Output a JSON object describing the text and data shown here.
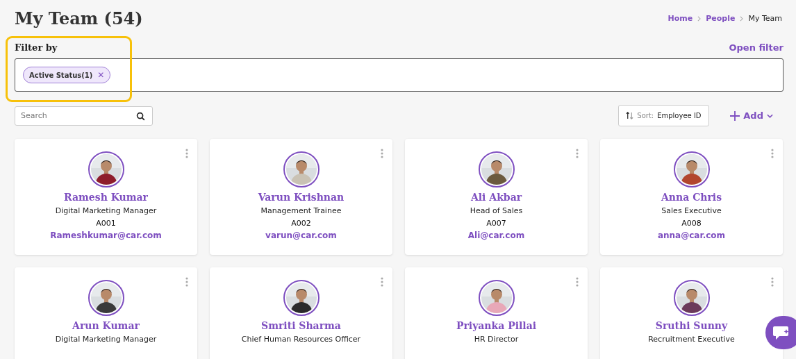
{
  "page": {
    "title": "My Team (54)"
  },
  "breadcrumb": [
    {
      "label": "Home",
      "current": false
    },
    {
      "label": "People",
      "current": false
    },
    {
      "label": "My Team",
      "current": true
    }
  ],
  "filter": {
    "label": "Filter by",
    "open_link": "Open filter",
    "chips": [
      {
        "label": "Active Status(1)",
        "remove": "✕"
      }
    ]
  },
  "search": {
    "placeholder": "Search"
  },
  "sort": {
    "label": "Sort:",
    "value": "Employee ID"
  },
  "add": {
    "label": "Add"
  },
  "members": [
    {
      "name": "Ramesh Kumar",
      "title": "Digital Marketing Manager",
      "id": "A001",
      "email": "Rameshkumar@car.com"
    },
    {
      "name": "Varun Krishnan",
      "title": "Management Trainee",
      "id": "A002",
      "email": "varun@car.com"
    },
    {
      "name": "Ali Akbar",
      "title": "Head of Sales",
      "id": "A007",
      "email": "Ali@car.com"
    },
    {
      "name": "Anna Chris",
      "title": "Sales Executive",
      "id": "A008",
      "email": "anna@car.com"
    },
    {
      "name": "Arun Kumar",
      "title": "Digital Marketing Manager"
    },
    {
      "name": "Smriti Sharma",
      "title": "Chief Human Resources Officer"
    },
    {
      "name": "Priyanka Pillai",
      "title": "HR Director"
    },
    {
      "name": "Sruthi Sunny",
      "title": "Recruitment Executive"
    }
  ]
}
